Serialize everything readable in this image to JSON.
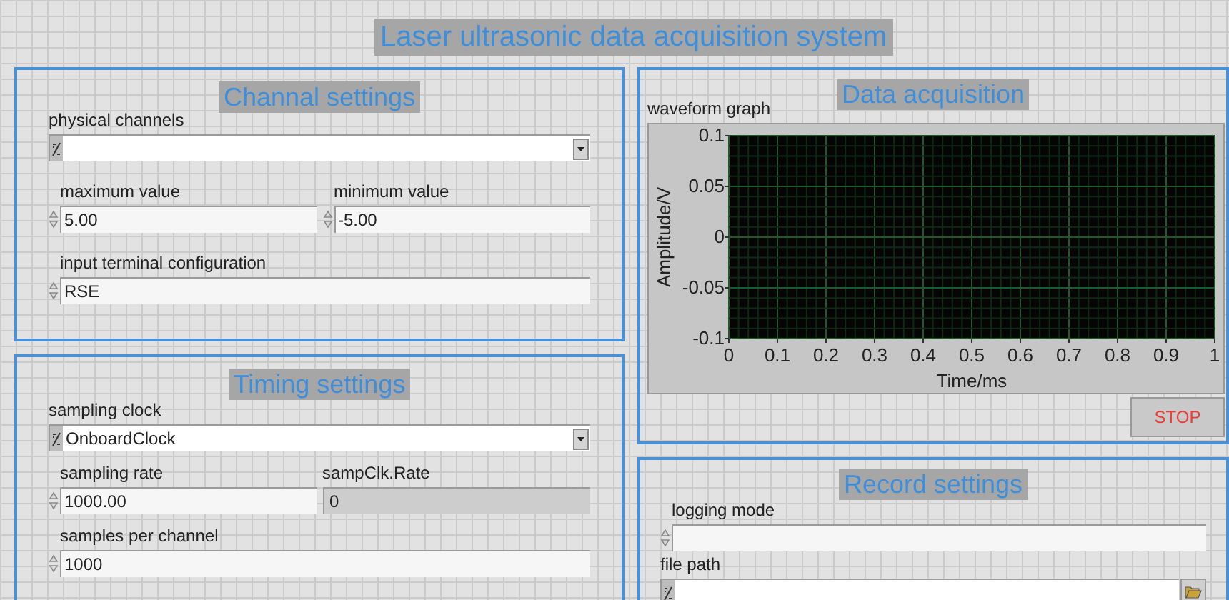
{
  "window": {
    "title": "Laser ultrasonic data acquisition system"
  },
  "channel_settings": {
    "title": "Channal settings",
    "rows": [
      [
        {
          "kind": "io",
          "label": "physical channels"
        }
      ],
      [
        {
          "kind": "numeric",
          "label": "maximum value",
          "value": "5.00"
        },
        {
          "kind": "numeric",
          "label": "minimum value",
          "value": "-5.00"
        }
      ],
      [
        {
          "kind": "numeric",
          "label": "input terminal configuration",
          "value": "RSE"
        }
      ]
    ]
  },
  "timing_settings": {
    "title": "Timing settings",
    "rows": [
      [
        {
          "kind": "io",
          "label": "sampling clock",
          "value": "OnboardClock"
        }
      ],
      [
        {
          "kind": "numeric",
          "label": "sampling rate",
          "value": "1000.00"
        },
        {
          "kind": "indicator",
          "label": "sampClk.Rate",
          "value": "0"
        }
      ],
      [
        {
          "kind": "numeric",
          "label": "samples per channel",
          "value": "1000"
        }
      ]
    ]
  },
  "data_acquisition": {
    "title": "Data acquisition",
    "graph": {
      "label": "waveform graph",
      "chart_data": {
        "type": "line",
        "grid": true,
        "xlabel": "Time/ms",
        "ylabel": "Amplitude/V",
        "xlim": [
          0,
          1
        ],
        "ylim": [
          -0.1,
          0.1
        ],
        "xticks": [
          0,
          0.1,
          0.2,
          0.3,
          0.4,
          0.5,
          0.6,
          0.7,
          0.8,
          0.9,
          1
        ],
        "yticks": [
          -0.1,
          -0.05,
          0,
          0.05,
          0.1
        ]
      }
    },
    "stop_button": "STOP"
  },
  "record_settings": {
    "title": "Record settings",
    "rows": [
      [
        {
          "kind": "numeric",
          "label": "logging mode"
        }
      ],
      [
        {
          "kind": "path",
          "label": "file path"
        }
      ]
    ]
  }
}
